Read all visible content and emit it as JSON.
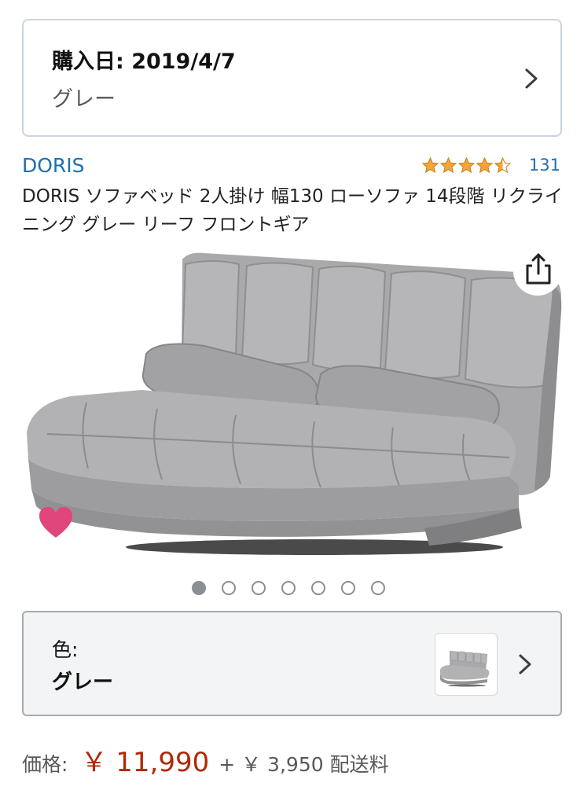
{
  "purchase": {
    "date_text": "購入日: 2019/4/7",
    "variant": "グレー",
    "chevron_icon": "chevron-right-icon"
  },
  "product": {
    "brand": "DORIS",
    "rating_stars": 4.5,
    "review_count": "131",
    "title": "DORIS ソファベッド 2人掛け 幅130 ローソファ 14段階 リクライニング グレー リーフ フロントギア"
  },
  "gallery": {
    "image_count": 7,
    "active_index": 0,
    "share_icon": "share-icon",
    "favorite_icon": "heart-icon"
  },
  "color_selector": {
    "label": "色:",
    "value": "グレー"
  },
  "price": {
    "label": "価格:",
    "amount": "￥ 11,990",
    "shipping": "+ ￥ 3,950 配送料"
  },
  "colors": {
    "link": "#1e6fb0",
    "price": "#b12704",
    "star": "#f0a63a",
    "heart": "#e0457b"
  }
}
